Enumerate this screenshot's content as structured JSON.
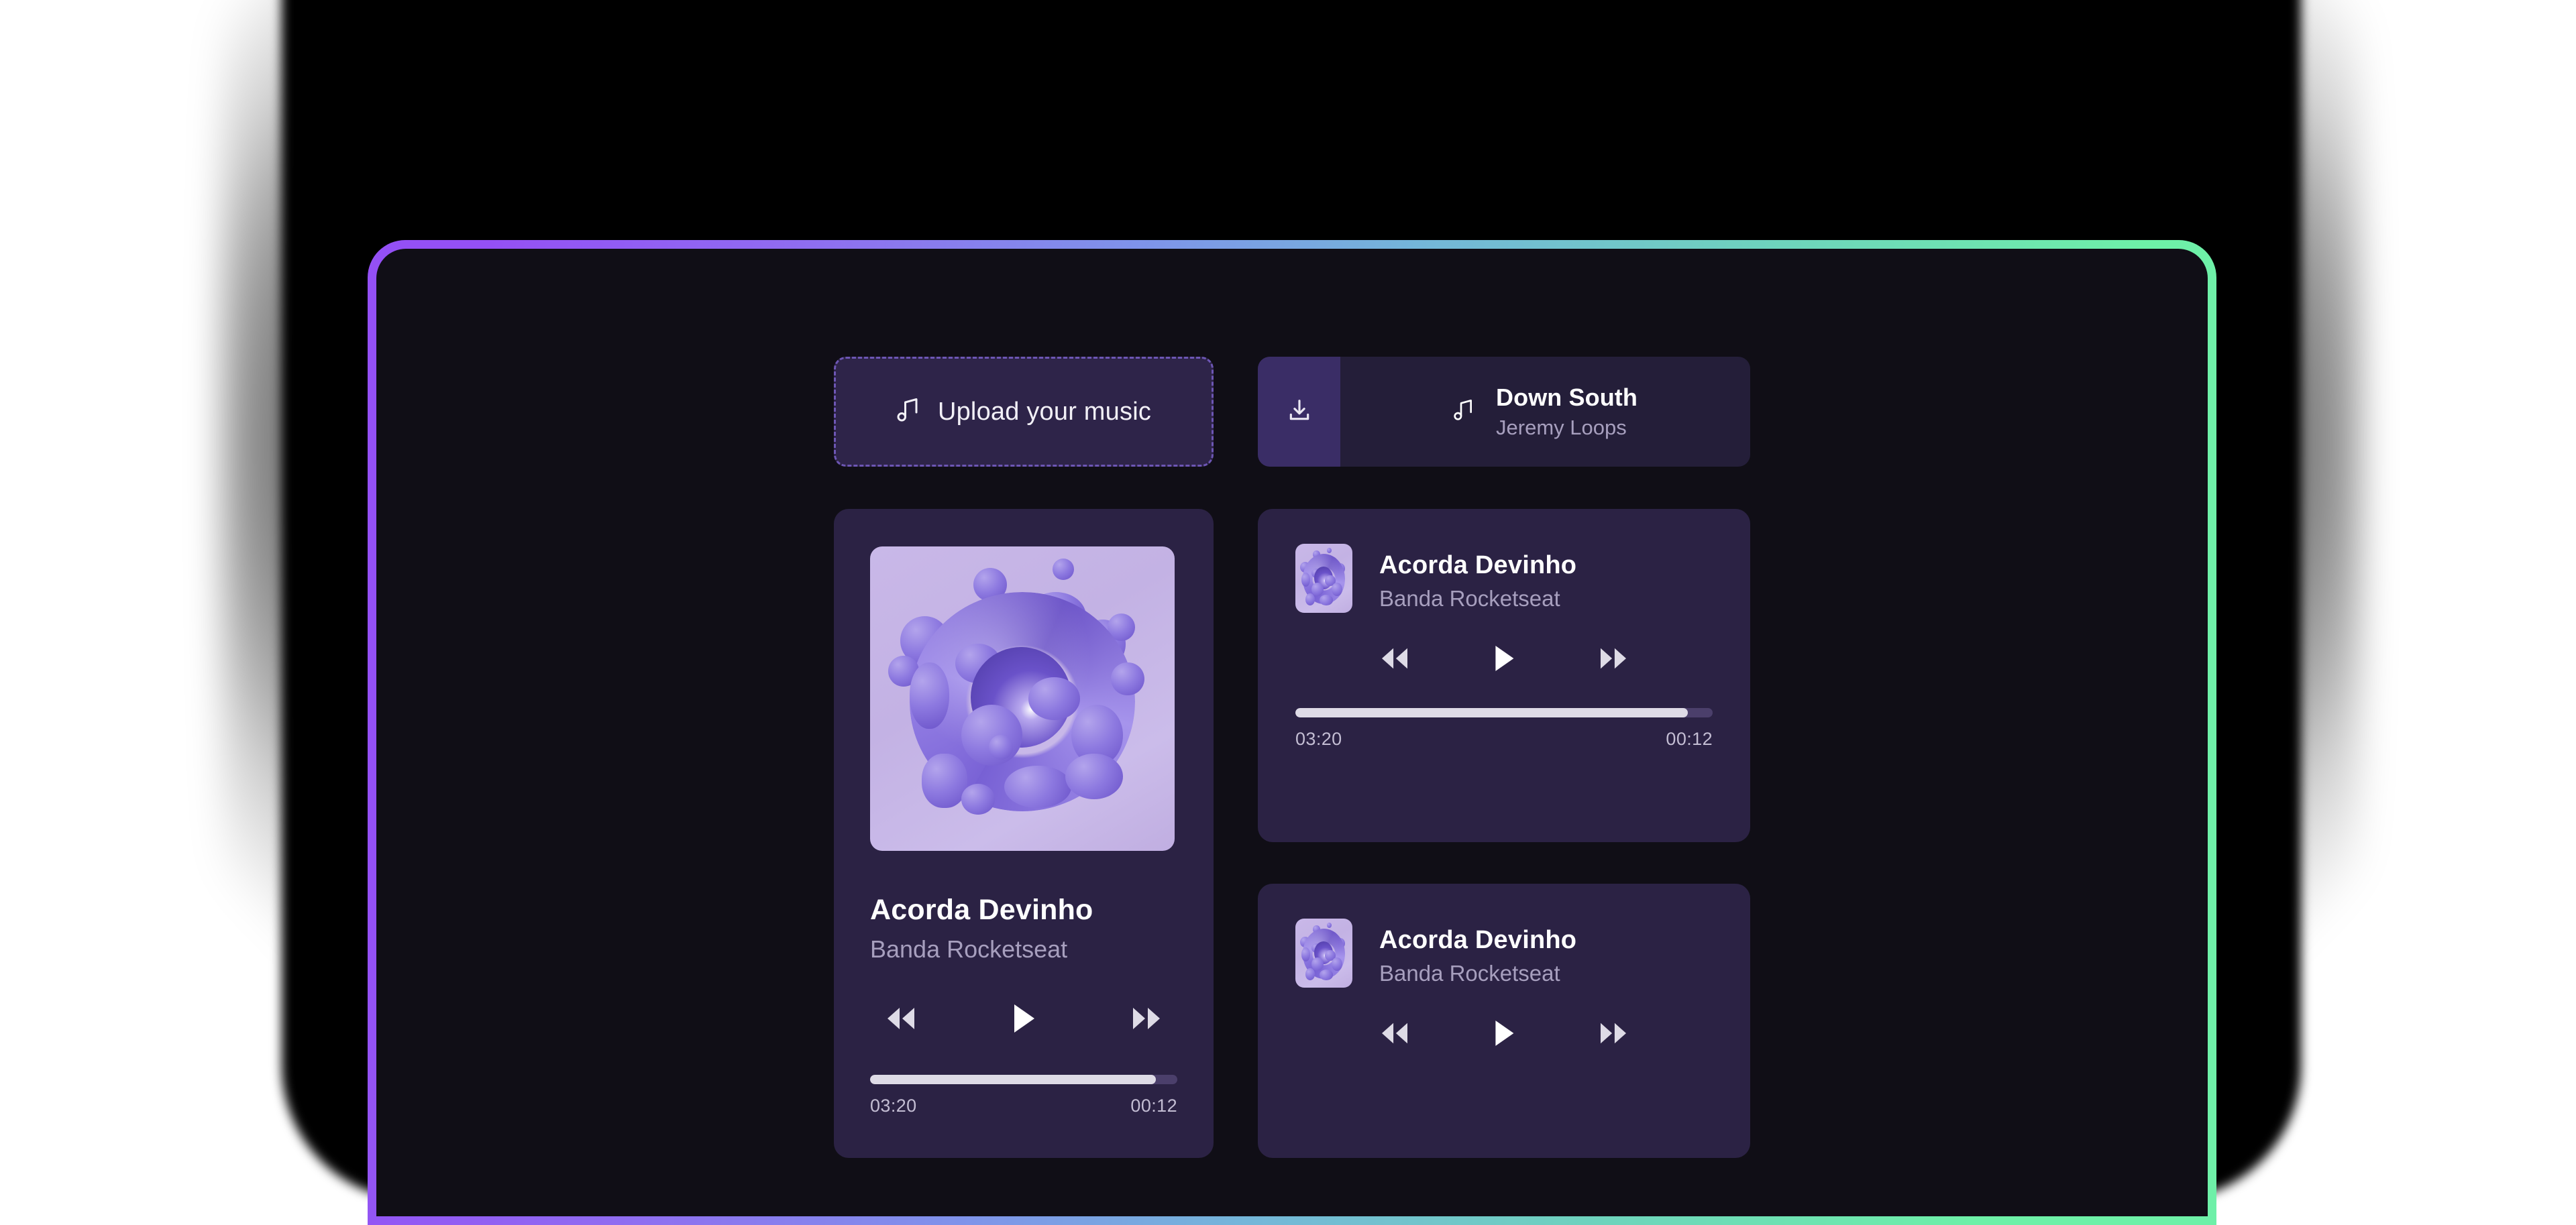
{
  "theme": {
    "frame_gradient_start": "#9450f5",
    "frame_gradient_end": "#6ef0a8",
    "screen_bg": "#100e16",
    "card_bg": "#2b2244",
    "accent_purple": "#3a2d66",
    "text_primary": "#ffffff",
    "text_secondary": "#a79fbe",
    "progress_fill": "#dedbe6",
    "progress_track": "#4b3f6b"
  },
  "upload": {
    "label": "Upload your music",
    "icon": "music-note-icon"
  },
  "now_playing": {
    "download_icon": "download-icon",
    "note_icon": "music-note-icon",
    "title": "Down South",
    "artist": "Jeremy Loops"
  },
  "featured_player": {
    "artwork_alt": "abstract-3d-purple-blob-album-art",
    "title": "Acorda Devinho",
    "artist": "Banda Rocketseat",
    "controls": {
      "rewind": "rewind-icon",
      "play": "play-icon",
      "forward": "fast-forward-icon"
    },
    "progress_percent": 93,
    "time_total": "03:20",
    "time_current": "00:12"
  },
  "track_cards": [
    {
      "artwork_alt": "abstract-3d-purple-blob-album-art",
      "title": "Acorda Devinho",
      "artist": "Banda Rocketseat",
      "controls": {
        "rewind": "rewind-icon",
        "play": "play-icon",
        "forward": "fast-forward-icon"
      },
      "has_progress": true,
      "progress_percent": 94,
      "time_total": "03:20",
      "time_current": "00:12"
    },
    {
      "artwork_alt": "abstract-3d-purple-blob-album-art",
      "title": "Acorda Devinho",
      "artist": "Banda Rocketseat",
      "controls": {
        "rewind": "rewind-icon",
        "play": "play-icon",
        "forward": "fast-forward-icon"
      },
      "has_progress": false
    }
  ]
}
